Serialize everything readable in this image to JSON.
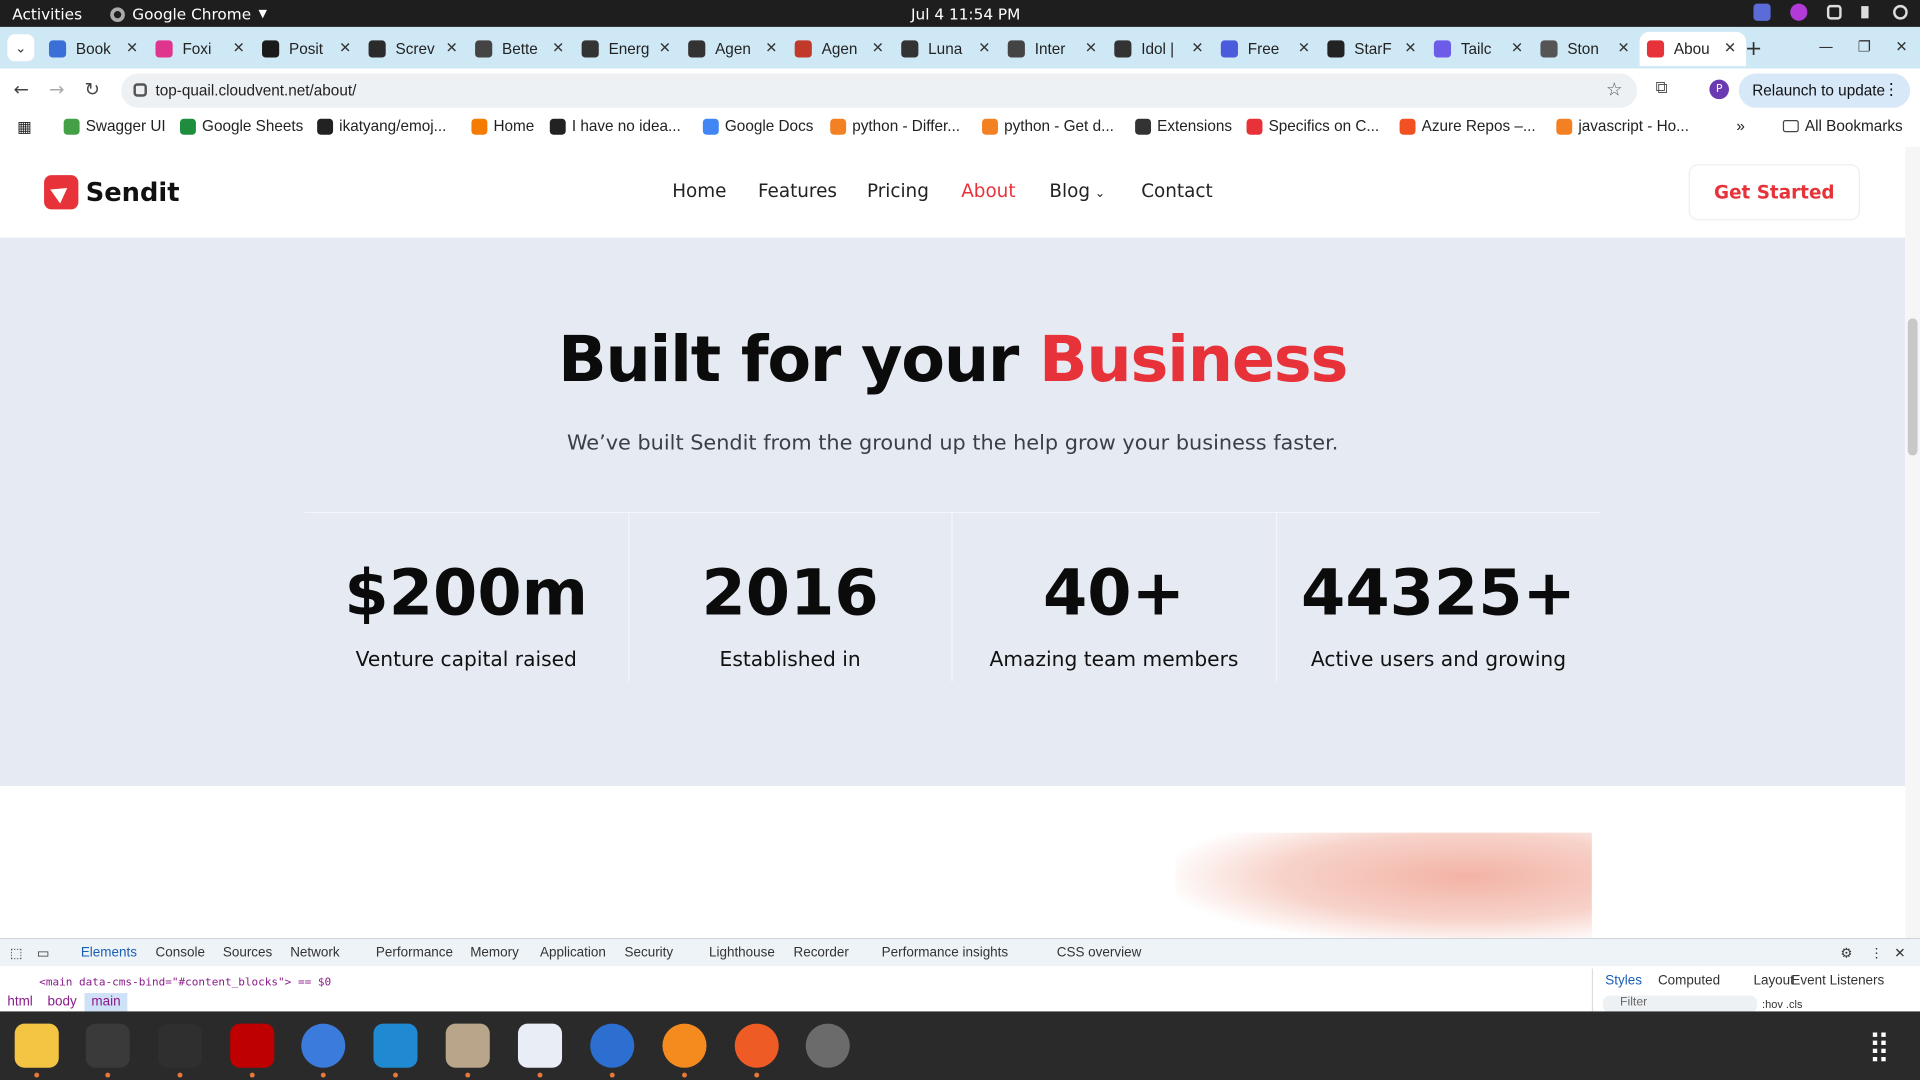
{
  "system": {
    "activities": "Activities",
    "app_name": "Google Chrome",
    "clock": "Jul 4  11:54 PM"
  },
  "tabs": [
    {
      "title": "Book",
      "color": "#3b6fd8"
    },
    {
      "title": "Foxi",
      "color": "#e0358f"
    },
    {
      "title": "Posit",
      "color": "#1a1a1a"
    },
    {
      "title": "Screv",
      "color": "#2b2b2b"
    },
    {
      "title": "Bette",
      "color": "#444444"
    },
    {
      "title": "Energ",
      "color": "#333333"
    },
    {
      "title": "Agen",
      "color": "#333333"
    },
    {
      "title": "Agen",
      "color": "#c0392b"
    },
    {
      "title": "Luna",
      "color": "#333333"
    },
    {
      "title": "Inter",
      "color": "#444444"
    },
    {
      "title": "Idol |",
      "color": "#333333"
    },
    {
      "title": "Free",
      "color": "#4a5bdc"
    },
    {
      "title": "StarF",
      "color": "#222222"
    },
    {
      "title": "Tailc",
      "color": "#6c5ce7"
    },
    {
      "title": "Ston",
      "color": "#555555"
    },
    {
      "title": "Abou",
      "color": "#e8323a"
    }
  ],
  "omnibox": {
    "url": "top-quail.cloudvent.net/about/"
  },
  "relaunch_label": "Relaunch to update",
  "profile_initial": "P",
  "bookmarks": {
    "items": [
      {
        "label": "Swagger UI",
        "color": "#43a047"
      },
      {
        "label": "Google Sheets",
        "color": "#1e8e3e"
      },
      {
        "label": "ikatyang/emoj...",
        "color": "#222222"
      },
      {
        "label": "Home",
        "color": "#f57c00"
      },
      {
        "label": "I have no idea...",
        "color": "#222222"
      },
      {
        "label": "Google Docs",
        "color": "#4285f4"
      },
      {
        "label": "python - Differ...",
        "color": "#f48024"
      },
      {
        "label": "python - Get d...",
        "color": "#f48024"
      },
      {
        "label": "Extensions",
        "color": "#333333"
      },
      {
        "label": "Specifics on C...",
        "color": "#e8323a"
      },
      {
        "label": "Azure Repos –...",
        "color": "#f25022"
      },
      {
        "label": "javascript - Ho...",
        "color": "#f48024"
      }
    ],
    "more": "»",
    "all": "All Bookmarks"
  },
  "site": {
    "brand": "Sendit",
    "accent": "#e8323a",
    "nav": [
      "Home",
      "Features",
      "Pricing",
      "About",
      "Blog",
      "Contact"
    ],
    "active_nav": "About",
    "cta": "Get Started",
    "hero": {
      "title_plain": "Built for your ",
      "title_highlight": "Business",
      "subtitle": "We’ve built Sendit from the ground up the help grow your business faster."
    },
    "stats": [
      {
        "value": "$200m",
        "label": "Venture capital raised"
      },
      {
        "value": "2016",
        "label": "Established in"
      },
      {
        "value": "40+",
        "label": "Amazing team members"
      },
      {
        "value": "44325+",
        "label": "Active users and growing"
      }
    ]
  },
  "devtools": {
    "tabs": [
      "Elements",
      "Console",
      "Sources",
      "Network",
      "Performance",
      "Memory",
      "Application",
      "Security",
      "Lighthouse",
      "Recorder",
      "Performance insights",
      "CSS overview"
    ],
    "code_line": "<main data-cms-bind=\"#content_blocks\"> == $0",
    "breadcrumbs": [
      "html",
      "body",
      "main"
    ],
    "side_tabs": [
      "Styles",
      "Computed",
      "Layout",
      "Event Listeners"
    ],
    "filter_placeholder": "Filter",
    "filter_actions": ":hov .cls"
  },
  "dock": [
    {
      "name": "notes",
      "color": "#f4c542"
    },
    {
      "name": "system-monitor",
      "color": "#3a3a3a"
    },
    {
      "name": "terminal",
      "color": "#2f2f2f"
    },
    {
      "name": "filezilla",
      "color": "#bf0000"
    },
    {
      "name": "chrome",
      "color": "#3b7bdc"
    },
    {
      "name": "vscode",
      "color": "#1f8ad2"
    },
    {
      "name": "files",
      "color": "#b8a58a"
    },
    {
      "name": "text-editor",
      "color": "#e9edf5"
    },
    {
      "name": "thunderbird",
      "color": "#2c6fd1"
    },
    {
      "name": "firefox",
      "color": "#f58b1f"
    },
    {
      "name": "postman",
      "color": "#ef5b25"
    },
    {
      "name": "trash",
      "color": "#6b6b6b"
    }
  ]
}
